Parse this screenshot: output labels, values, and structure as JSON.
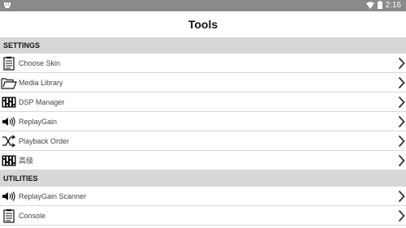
{
  "status_bar": {
    "time": "2:16",
    "icons": [
      "android-debug-icon",
      "wifi-icon",
      "battery-icon"
    ]
  },
  "header": {
    "title": "Tools"
  },
  "sections": [
    {
      "title": "SETTINGS",
      "items": [
        {
          "label": "Choose Skin",
          "icon": "clipboard-icon"
        },
        {
          "label": "Media Library",
          "icon": "folder-icon"
        },
        {
          "label": "DSP Manager",
          "icon": "equalizer-icon"
        },
        {
          "label": "ReplayGain",
          "icon": "speaker-icon"
        },
        {
          "label": "Playback Order",
          "icon": "shuffle-icon"
        },
        {
          "label": "高级",
          "icon": "equalizer-icon"
        }
      ]
    },
    {
      "title": "UTILITIES",
      "items": [
        {
          "label": "ReplayGain Scanner",
          "icon": "speaker-icon"
        },
        {
          "label": "Console",
          "icon": "clipboard-icon"
        }
      ]
    }
  ],
  "colors": {
    "status_bar_bg": "#8a8a8a",
    "section_bg": "#d7d7d7",
    "divider": "#d8d8d8",
    "text": "#444444"
  }
}
